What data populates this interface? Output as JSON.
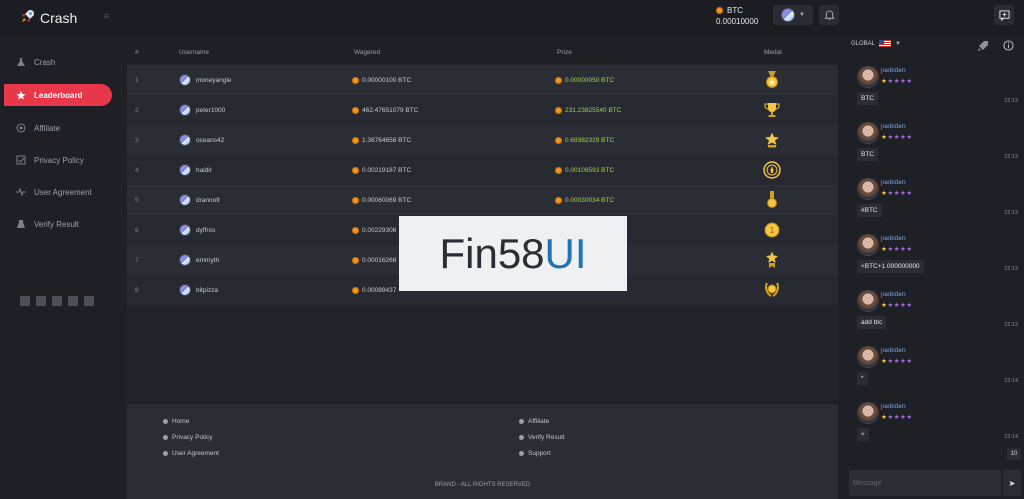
{
  "app": {
    "name": "Crash"
  },
  "header": {
    "currency": "BTC",
    "balance": "0.00010000"
  },
  "sidebar": {
    "items": [
      {
        "label": "Crash",
        "icon": "flask-icon"
      },
      {
        "label": "Leaderboard",
        "icon": "star-icon",
        "active": true
      },
      {
        "label": "Affiliate",
        "icon": "target-icon"
      },
      {
        "label": "Privacy Policy",
        "icon": "checklist-icon"
      },
      {
        "label": "User Agreement",
        "icon": "pulse-icon"
      },
      {
        "label": "Verify Result",
        "icon": "beaker-icon"
      }
    ],
    "socials": [
      "facebook-icon",
      "twitter-icon",
      "discord-icon",
      "instagram-icon",
      "vk-icon"
    ]
  },
  "table": {
    "headers": {
      "rank": "#",
      "username": "Username",
      "wagered": "Wagered",
      "prize": "Prize",
      "medal": "Medal"
    },
    "rows": [
      {
        "rank": "1",
        "username": "moneyangle",
        "wagered": "0.00000100 BTC",
        "prize": "0.00000050 BTC",
        "medal": "gold-medal-icon"
      },
      {
        "rank": "2",
        "username": "peter1000",
        "wagered": "462.47651079 BTC",
        "prize": "231.23825540 BTC",
        "medal": "trophy-icon"
      },
      {
        "rank": "3",
        "username": "oceans42",
        "wagered": "1.38764658 BTC",
        "prize": "0.69382329 BTC",
        "medal": "star-medal-icon"
      },
      {
        "rank": "4",
        "username": "haldir",
        "wagered": "0.00219187 BTC",
        "prize": "0.00109593 BTC",
        "medal": "round-medal-icon"
      },
      {
        "rank": "5",
        "username": "drannofr",
        "wagered": "0.00060069 BTC",
        "prize": "0.00030034 BTC",
        "medal": "ribbon-medal-icon"
      },
      {
        "rank": "6",
        "username": "dyffros",
        "wagered": "0.00229306",
        "prize": "",
        "medal": "coin-medal-icon"
      },
      {
        "rank": "7",
        "username": "emmyth",
        "wagered": "0.00016268",
        "prize": "",
        "medal": "star-ribbon-icon"
      },
      {
        "rank": "8",
        "username": "bitpizza",
        "wagered": "0.00089437",
        "prize": "",
        "medal": "wreath-medal-icon"
      }
    ]
  },
  "watermark": {
    "part1": "Fin58",
    "part2": "UI"
  },
  "footer": {
    "links_left": [
      "Home",
      "Privacy Policy",
      "User Agreement"
    ],
    "links_right": [
      "Affiliate",
      "Verify Result",
      "Support"
    ],
    "copyright": "BRAND - ALL RIGHTS RESERVED"
  },
  "chat": {
    "region": "GLOBAL",
    "messages": [
      {
        "user": "joebiden",
        "text": "BTC",
        "time": "12:13"
      },
      {
        "user": "joebiden",
        "text": "BTC",
        "time": "12:13"
      },
      {
        "user": "joebiden",
        "text": "#BTC",
        "time": "12:13"
      },
      {
        "user": "joebiden",
        "text": "+BTC+1.000000000",
        "time": "12:13"
      },
      {
        "user": "joebiden",
        "text": "add btc",
        "time": "12:12"
      },
      {
        "user": "joebiden",
        "text": "*",
        "time": "12:14"
      },
      {
        "user": "joebiden",
        "text": "+",
        "time": "12:14"
      }
    ],
    "unread_count": "10",
    "input_placeholder": "Message"
  },
  "colors": {
    "accent": "#e8374a",
    "prize": "#a3d64a",
    "btc": "#f7931a"
  }
}
